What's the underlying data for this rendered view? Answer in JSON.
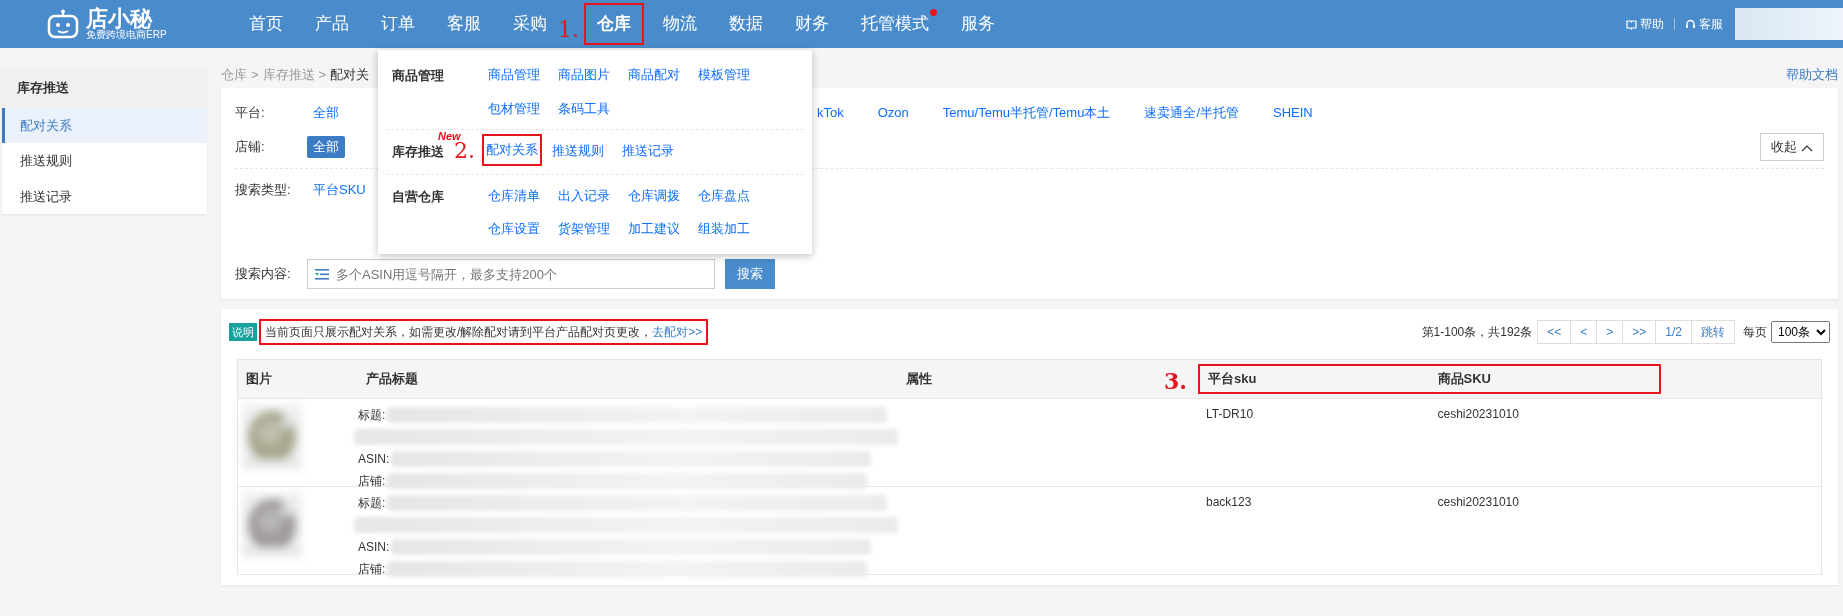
{
  "nav": {
    "logo": {
      "name": "店小秘",
      "tagline": "免费跨境电商ERP"
    },
    "items": [
      {
        "label": "首页",
        "selected": false,
        "dot": false
      },
      {
        "label": "产品",
        "selected": false,
        "dot": false
      },
      {
        "label": "订单",
        "selected": false,
        "dot": false
      },
      {
        "label": "客服",
        "selected": false,
        "dot": false
      },
      {
        "label": "采购",
        "selected": false,
        "dot": false
      },
      {
        "label": "仓库",
        "selected": true,
        "dot": false,
        "highlighted": true,
        "annotation": "1."
      },
      {
        "label": "物流",
        "selected": false,
        "dot": false
      },
      {
        "label": "数据",
        "selected": false,
        "dot": false
      },
      {
        "label": "财务",
        "selected": false,
        "dot": false
      },
      {
        "label": "托管模式",
        "selected": false,
        "dot": true
      },
      {
        "label": "服务",
        "selected": false,
        "dot": false
      }
    ],
    "links": [
      "帮助",
      "客服"
    ]
  },
  "dropdown": {
    "groups": [
      {
        "title": "商品管理",
        "items": [
          {
            "label": "商品管理"
          },
          {
            "label": "商品图片"
          },
          {
            "label": "商品配对"
          },
          {
            "label": "模板管理"
          },
          {
            "label": "包材管理"
          },
          {
            "label": "条码工具"
          }
        ]
      },
      {
        "title": "库存推送",
        "items": [
          {
            "label": "配对关系",
            "highlighted": true,
            "annotation": "2.",
            "tag": "New"
          },
          {
            "label": "推送规则"
          },
          {
            "label": "推送记录"
          }
        ]
      },
      {
        "title": "自营仓库",
        "items": [
          {
            "label": "仓库清单"
          },
          {
            "label": "出入记录"
          },
          {
            "label": "仓库调拨"
          },
          {
            "label": "仓库盘点"
          },
          {
            "label": "仓库设置"
          },
          {
            "label": "货架管理"
          },
          {
            "label": "加工建议"
          },
          {
            "label": "组装加工"
          }
        ]
      }
    ]
  },
  "sidebar": {
    "title": "库存推送",
    "items": [
      {
        "label": "配对关系",
        "selected": true
      },
      {
        "label": "推送规则",
        "selected": false
      },
      {
        "label": "推送记录",
        "selected": false
      }
    ]
  },
  "breadcrumb": [
    {
      "label": "仓库"
    },
    {
      "separator": ">",
      "label": "库存推送"
    },
    {
      "separator": ">",
      "label": "配对关"
    }
  ],
  "help_link": "帮助文档",
  "filters": {
    "platform": {
      "label": "平台:",
      "options": [
        {
          "label": "全部",
          "selected": false
        },
        {
          "label": "kTok",
          "selected": false
        },
        {
          "label": "Ozon",
          "selected": false
        },
        {
          "label": "Temu/Temu半托管/Temu本土",
          "selected": false
        },
        {
          "label": "速卖通全/半托管",
          "selected": false
        },
        {
          "label": "SHEIN",
          "selected": false
        }
      ]
    },
    "store": {
      "label": "店铺:",
      "options": [
        {
          "label": "全部",
          "selected": true
        }
      ]
    },
    "collapse": "收起",
    "search_type": {
      "label": "搜索类型:",
      "options": [
        {
          "label": "平台SKU",
          "selected": false
        }
      ]
    },
    "search": {
      "label": "搜索内容:",
      "placeholder": "多个ASIN用逗号隔开，最多支持200个",
      "button": "搜索"
    }
  },
  "notice": {
    "tag": "说明",
    "text": "当前页面只展示配对关系，如需更改/解除配对请到平台产品配对页更改，",
    "link": "去配对>>",
    "highlighted": true
  },
  "pagination": {
    "summary": "第1-100条，共192条",
    "buttons": [
      "<<",
      "<",
      ">",
      ">>",
      "1/2",
      "跳转"
    ],
    "per_page_label": "每页",
    "per_page": "100条"
  },
  "table": {
    "annotation": "3.",
    "columns": [
      {
        "label": "图片",
        "highlighted": false
      },
      {
        "label": "产品标题",
        "highlighted": false
      },
      {
        "label": "属性",
        "highlighted": false
      },
      {
        "label": "平台sku",
        "highlighted": true
      },
      {
        "label": "商品SKU",
        "highlighted": true
      }
    ],
    "rows": [
      {
        "title_label": "标题:",
        "asin_label": "ASIN:",
        "store_label": "店铺:",
        "platform_sku": "LT-DR10",
        "product_sku": "ceshi20231010",
        "color": "#a8a890"
      },
      {
        "title_label": "标题:",
        "asin_label": "ASIN:",
        "store_label": "店铺:",
        "platform_sku": "back123",
        "product_sku": "ceshi20231010",
        "color": "#a09c9c"
      }
    ]
  }
}
